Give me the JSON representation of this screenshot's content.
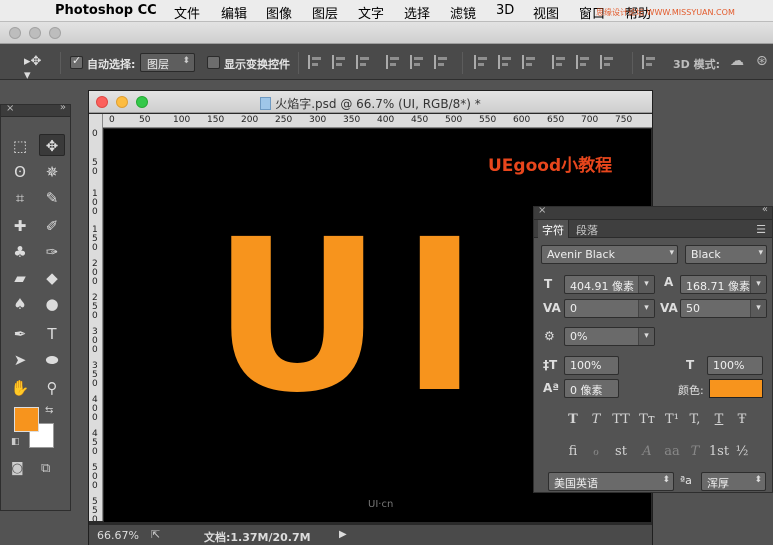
{
  "menubar": {
    "app_name": "Photoshop CC",
    "menus": [
      "文件",
      "编辑",
      "图像",
      "图层",
      "文字",
      "选择",
      "滤镜",
      "3D",
      "视图",
      "窗口",
      "帮助"
    ],
    "watermark": "思缘设计论坛 WWW.MISSYUAN.COM"
  },
  "options": {
    "auto_select_label": "自动选择:",
    "auto_select_checked": true,
    "auto_select_target": "图层",
    "show_transform_label": "显示变换控件",
    "show_transform_checked": false,
    "mode_3d_label": "3D 模式:"
  },
  "document": {
    "title": "火焰字.psd @ 66.7% (UI, RGB/8*) *",
    "ruler_h": [
      "0",
      "50",
      "100",
      "150",
      "200",
      "250",
      "300",
      "350",
      "400",
      "450",
      "500",
      "550",
      "600",
      "650",
      "700",
      "750"
    ],
    "ruler_v": [
      "0",
      "5 0",
      "1 0 0",
      "1 5 0",
      "2 0 0",
      "2 5 0",
      "3 0 0",
      "3 5 0",
      "4 0 0",
      "4 5 0",
      "5 0 0",
      "5 5 0"
    ],
    "canvas_text": "UI",
    "canvas_brand": "UEgood小教程",
    "canvas_watermark": "UI·cn",
    "zoom": "66.67%",
    "doc_info": "文档:1.37M/20.7M"
  },
  "colors": {
    "foreground": "#f7941d",
    "background": "#ffffff",
    "brand_red": "#e8461c"
  },
  "character_panel": {
    "tabs": [
      "字符",
      "段落"
    ],
    "font_family": "Avenir Black",
    "font_style": "Black",
    "font_size": "404.91 像素",
    "leading": "168.71 像素",
    "kerning": "0",
    "tracking": "50",
    "tsume": "0%",
    "vertical_scale": "100%",
    "horizontal_scale": "100%",
    "baseline_shift": "0 像素",
    "color_label": "颜色:",
    "text_color": "#f7941d",
    "style_buttons": [
      "T",
      "T",
      "TT",
      "Tт",
      "T¹",
      "T,",
      "T",
      "Ŧ"
    ],
    "opentype_buttons": [
      "fi",
      "ℴ",
      "st",
      "A",
      "aa",
      "T",
      "1st",
      "½"
    ],
    "language": "美国英语",
    "aa_label": "ªa",
    "antialias": "浑厚"
  },
  "icons": {
    "tools": [
      "marquee-icon",
      "move-icon",
      "lasso-icon",
      "magic-wand-icon",
      "crop-icon",
      "eyedropper-icon",
      "healing-brush-icon",
      "brush-icon",
      "clone-stamp-icon",
      "history-brush-icon",
      "eraser-icon",
      "paint-bucket-icon",
      "blur-icon",
      "dodge-icon",
      "pen-icon",
      "type-icon",
      "path-selection-icon",
      "ellipse-icon",
      "hand-icon",
      "zoom-icon"
    ]
  }
}
